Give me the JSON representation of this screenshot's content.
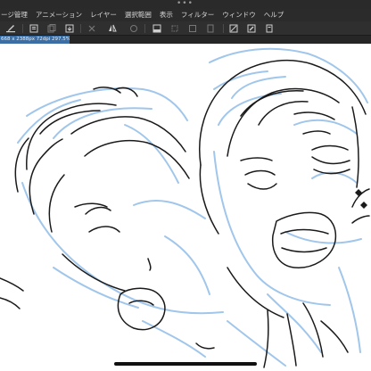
{
  "menubar": {
    "items": [
      {
        "label": "ージ管理"
      },
      {
        "label": "アニメーション"
      },
      {
        "label": "レイヤー"
      },
      {
        "label": "選択範囲"
      },
      {
        "label": "表示"
      },
      {
        "label": "フィルター"
      },
      {
        "label": "ウィンドウ"
      },
      {
        "label": "ヘルプ"
      }
    ]
  },
  "toolbar": {
    "icons": [
      "brush-icon",
      "layer-new-icon",
      "layer-copy-icon",
      "layer-export-icon",
      "clear-icon",
      "flip-horizontal-icon",
      "rotate-icon",
      "fill-icon",
      "transform-icon",
      "select-icon",
      "outline-icon",
      "ruler-icon"
    ]
  },
  "document": {
    "tab_label": "668 x 2388px 72dpi 297.5%"
  },
  "colors": {
    "menubar_bg": "#2b2b2b",
    "toolbar_bg": "#2f2f2f",
    "tab_accent": "#3a6ea5",
    "sketch_blue": "#9cc4ea",
    "ink_line": "#1a1a1a"
  }
}
